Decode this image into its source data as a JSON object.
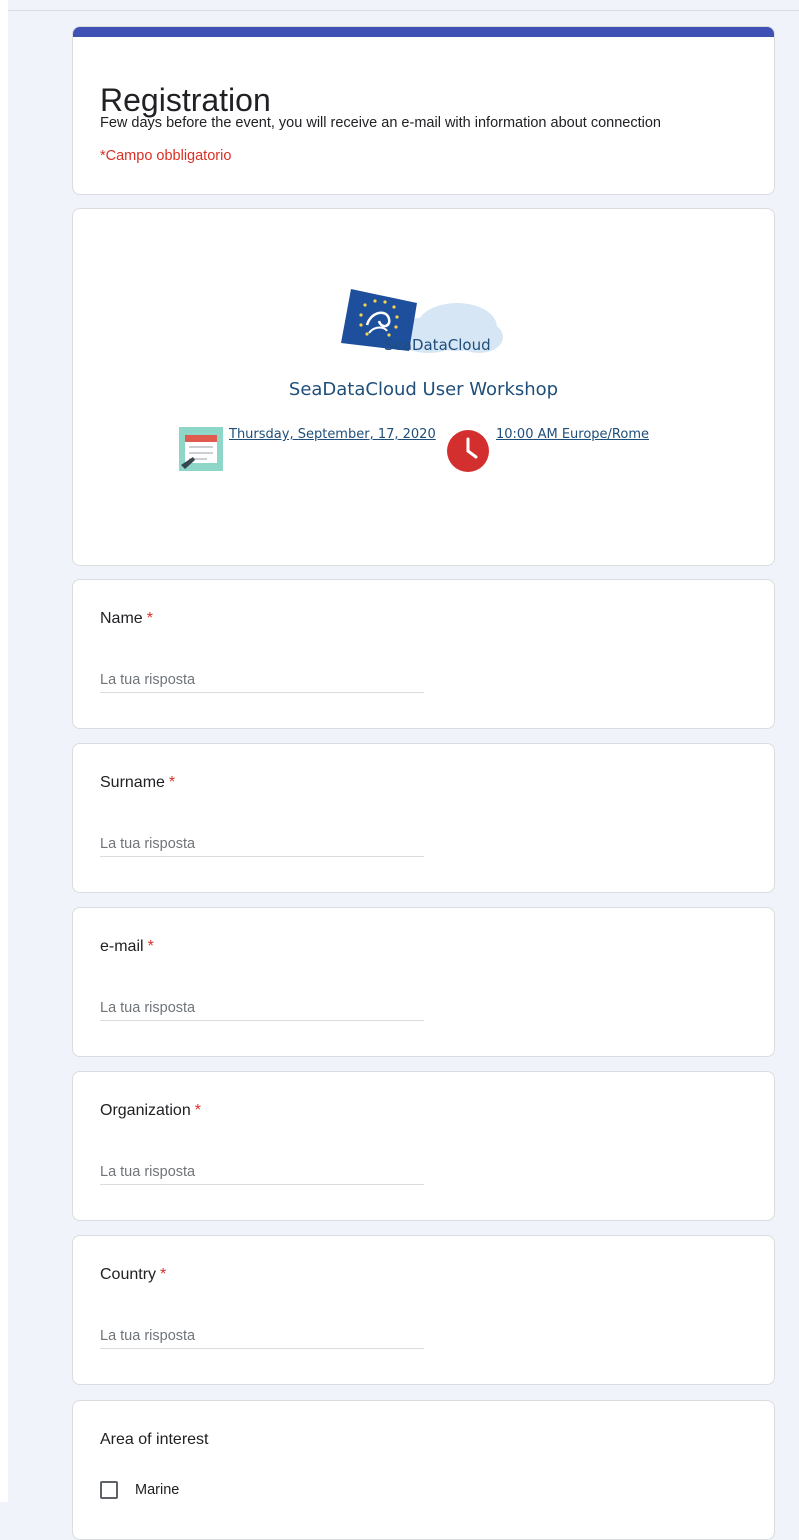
{
  "form": {
    "title": "Registration",
    "description": "Few days before the event, you will receive an e-mail with information about connection",
    "required_note": "*Campo obbligatorio",
    "accent_color": "#3f51b5"
  },
  "banner": {
    "logo_text": "SeaDataCloud",
    "workshop_title": "SeaDataCloud User Workshop",
    "date": "Thursday, September, 17, 2020",
    "time": "10:00 AM Europe/Rome",
    "calendar_icon": "calendar-icon",
    "clock_icon": "clock-icon"
  },
  "questions": [
    {
      "label": "Name",
      "required": "*",
      "placeholder": "La tua risposta"
    },
    {
      "label": "Surname",
      "required": "*",
      "placeholder": "La tua risposta"
    },
    {
      "label": "e-mail",
      "required": "*",
      "placeholder": "La tua risposta"
    },
    {
      "label": "Organization",
      "required": "*",
      "placeholder": "La tua risposta"
    },
    {
      "label": "Country",
      "required": "*",
      "placeholder": "La tua risposta"
    }
  ],
  "area_of_interest": {
    "label": "Area of interest",
    "options": [
      {
        "label": "Marine"
      }
    ]
  }
}
